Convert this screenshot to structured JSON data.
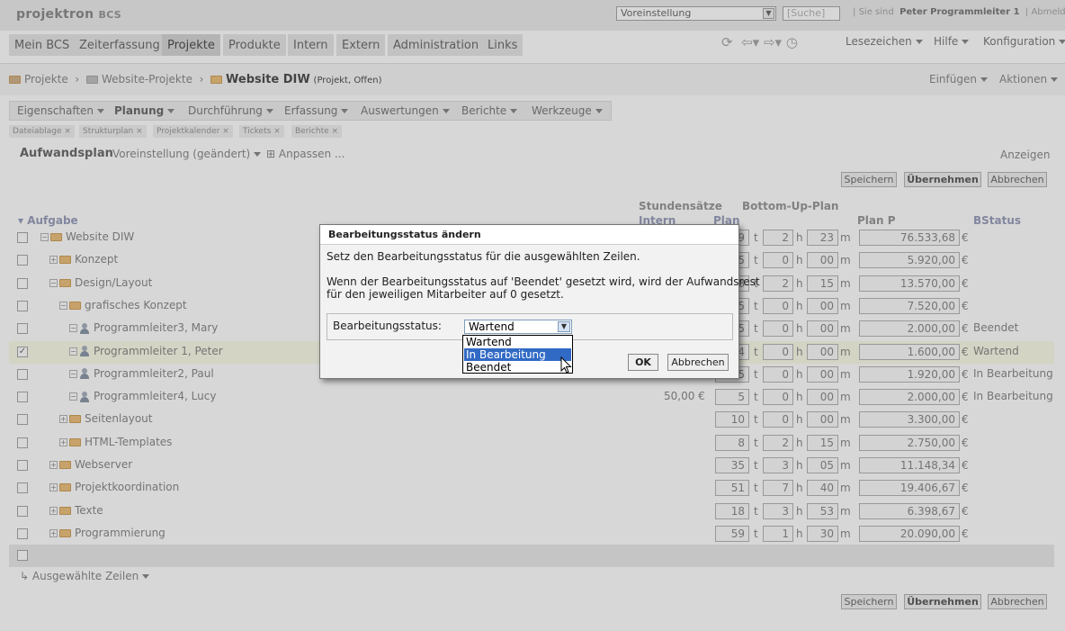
{
  "header": {
    "logo": "projektron",
    "logo_suffix": "BCS",
    "preset_value": "Voreinstellung",
    "search_placeholder": "Suche",
    "where_label": "Sie sind",
    "user": "Peter Programmleiter 1",
    "logout": "Abmelden"
  },
  "nav": {
    "tabs": [
      "Mein BCS",
      "Zeiterfassung",
      "Projekte",
      "Produkte",
      "Intern",
      "Extern",
      "Administration",
      "Links"
    ],
    "right": [
      "Lesezeichen",
      "Hilfe",
      "Konfiguration"
    ]
  },
  "breadcrumb": {
    "items": [
      "Projekte",
      "Website-Projekte"
    ],
    "current": "Website DIW",
    "current_note": "(Projekt, Offen)",
    "actions": [
      "Einfügen",
      "Aktionen"
    ]
  },
  "subnav": [
    "Eigenschaften",
    "Planung",
    "Durchführung",
    "Erfassung",
    "Auswertungen",
    "Berichte",
    "Werkzeuge"
  ],
  "subtabs": [
    "Dateiablage",
    "Strukturplan",
    "Projektkalender",
    "Tickets",
    "Berichte"
  ],
  "toolbar": {
    "title": "Aufwandsplan",
    "preset": "Voreinstellung (geändert)",
    "customize": "Anpassen ...",
    "show": "Anzeigen",
    "save": "Speichern",
    "apply": "Übernehmen",
    "cancel": "Abbrechen"
  },
  "columns": {
    "group1": "Stundensätze",
    "group2": "Bottom-Up-Plan",
    "task": "Aufgabe",
    "intern": "Intern",
    "plan": "Plan",
    "plan_p": "Plan P",
    "bstatus": "BStatus"
  },
  "rows": [
    {
      "name": "Website DIW",
      "t": "9",
      "h": "2",
      "m": "23",
      "planp": "76.533,68",
      "bstatus": "",
      "checked": false
    },
    {
      "name": "Konzept",
      "t": "5",
      "h": "0",
      "m": "00",
      "planp": "5.920,00",
      "bstatus": "",
      "checked": false
    },
    {
      "name": "Design/Layout",
      "t": "8",
      "h": "2",
      "m": "15",
      "planp": "13.570,00",
      "bstatus": "",
      "checked": false
    },
    {
      "name": "grafisches Konzept",
      "t": "5",
      "h": "0",
      "m": "00",
      "planp": "7.520,00",
      "bstatus": "",
      "checked": false
    },
    {
      "name": "Programmleiter3, Mary",
      "t": "5",
      "h": "0",
      "m": "00",
      "planp": "2.000,00",
      "bstatus": "Beendet",
      "checked": false
    },
    {
      "name": "Programmleiter 1, Peter",
      "t": "4",
      "h": "0",
      "m": "00",
      "planp": "1.600,00",
      "bstatus": "Wartend",
      "checked": true
    },
    {
      "name": "Programmleiter2, Paul",
      "t": "5",
      "h": "0",
      "m": "00",
      "planp": "1.920,00",
      "bstatus": "In Bearbeitung",
      "checked": false
    },
    {
      "name": "Programmleiter4, Lucy",
      "rate": "50,00 €",
      "t": "5",
      "h": "0",
      "m": "00",
      "planp": "2.000,00",
      "bstatus": "In Bearbeitung",
      "checked": false
    },
    {
      "name": "Seitenlayout",
      "t": "10",
      "h": "0",
      "m": "00",
      "planp": "3.300,00",
      "bstatus": "",
      "checked": false
    },
    {
      "name": "HTML-Templates",
      "t": "8",
      "h": "2",
      "m": "15",
      "planp": "2.750,00",
      "bstatus": "",
      "checked": false
    },
    {
      "name": "Webserver",
      "t": "35",
      "h": "3",
      "m": "05",
      "planp": "11.148,34",
      "bstatus": "",
      "checked": false
    },
    {
      "name": "Projektkoordination",
      "t": "51",
      "h": "7",
      "m": "40",
      "planp": "19.406,67",
      "bstatus": "",
      "checked": false
    },
    {
      "name": "Texte",
      "t": "18",
      "h": "3",
      "m": "53",
      "planp": "6.398,67",
      "bstatus": "",
      "checked": false
    },
    {
      "name": "Programmierung",
      "t": "59",
      "h": "1",
      "m": "30",
      "planp": "20.090,00",
      "bstatus": "",
      "checked": false
    }
  ],
  "units": {
    "t": "t",
    "h": "h",
    "m": "m",
    "currency": "€"
  },
  "footer": {
    "selected_rows": "Ausgewählte Zeilen"
  },
  "dialog": {
    "title": "Bearbeitungsstatus ändern",
    "text1": "Setz den Bearbeitungsstatus für die ausgewählten Zeilen.",
    "text2": "Wenn der Bearbeitungsstatus auf 'Beendet' gesetzt wird, wird der Aufwandsrest",
    "text3": "für den jeweiligen Mitarbeiter auf 0 gesetzt.",
    "status_label": "Bearbeitungsstatus:",
    "selected": "Wartend",
    "options": [
      "Wartend",
      "In Bearbeitung",
      "Beendet"
    ],
    "highlighted": "In Bearbeitung",
    "ok": "OK",
    "cancel": "Abbrechen"
  }
}
